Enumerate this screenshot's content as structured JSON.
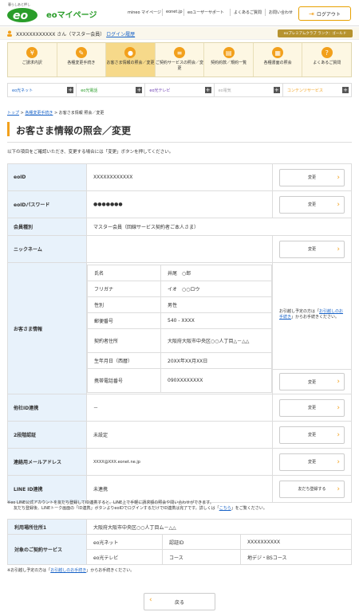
{
  "header": {
    "logo_tagline": "暮らしあと押し",
    "logo_text": "eo",
    "site_name": "eoマイページ",
    "links": [
      "mineo マイページ",
      "eonet.jp",
      "eoユーザーサポート",
      "よくあるご質問",
      "お問い合わせ"
    ],
    "logout_label": "ログアウト"
  },
  "user_bar": {
    "greeting": "XXXXXXXXXXXX さん（マスター会員）",
    "history_link": "ログイン履歴",
    "premium_badge": "eoプレミアムクラブ ランク：ゴールド"
  },
  "main_nav": [
    {
      "label": "ご請求内訳",
      "icon": "yen-icon"
    },
    {
      "label": "各種変更手続き",
      "icon": "pencil-icon"
    },
    {
      "label": "お客さま情報の照会／変更",
      "icon": "person-icon"
    },
    {
      "label": "ご契約サービスの照会／変更",
      "icon": "list-icon"
    },
    {
      "label": "契約約款／規約一覧",
      "icon": "book-icon"
    },
    {
      "label": "各種書面の照会",
      "icon": "document-icon"
    },
    {
      "label": "よくあるご質問",
      "icon": "question-icon"
    }
  ],
  "sub_nav": [
    "eo光ネット",
    "eo光電話",
    "eo光テレビ",
    "eo電気",
    "コンテンツサービス"
  ],
  "breadcrumb": [
    "トップ",
    "各種変更手続き",
    "お客さま情報 照会／変更"
  ],
  "page_title": "お客さま情報の照会／変更",
  "intro": "以下の項目をご確認いただき、変更する場合には「変更」ボタンを押してください。",
  "change_label": "変更",
  "rows": {
    "eoid": {
      "label": "eoID",
      "value": "XXXXXXXXXXXX"
    },
    "password": {
      "label": "eoIDパスワード",
      "value": "●●●●●●●"
    },
    "membership": {
      "label": "会員種別",
      "value": "マスター会員（回線サービス契約者ご本人さま）"
    },
    "nickname": {
      "label": "ニックネーム",
      "value": ""
    },
    "customer": {
      "label": "お客さま情報",
      "name_k": "氏名",
      "name_v": "井尾　○郎",
      "kana_k": "フリガナ",
      "kana_v": "イオ　○○ロウ",
      "sex_k": "性別",
      "sex_v": "男性",
      "zip_k": "郵便番号",
      "zip_v": "540 - XXXX",
      "addr_k": "契約者住所",
      "addr_v": "大阪府大阪市中央区○○人丁目△－△△",
      "birth_k": "生年月日（西暦）",
      "birth_v": "20XX年XX月XX日",
      "mobile_k": "携帯電話番号",
      "mobile_v": "090XXXXXXXX",
      "move_note_pre": "お引越し予定の方は「",
      "move_note_link": "お引越しのお手続き",
      "move_note_post": "」からお手続きください。"
    },
    "other_id": {
      "label": "他社ID連携",
      "value": "－"
    },
    "two_step": {
      "label": "2段階認証",
      "value": "未設定"
    },
    "email": {
      "label": "連絡用メールアドレス",
      "value": "XXXX@XXX.eonet.ne.jp"
    },
    "line": {
      "label": "LINE ID連携",
      "value": "未連携",
      "button": "友だち登録する"
    }
  },
  "line_note_1": "※eo LINE公式アカウントを友だち登録してID連携すると、LINE上で手軽に請求額の照会や問い合わせができます。",
  "line_note_2_pre": "友だち登録後、LINEトーク画面の「ID連携」ボタンよりeoIDでログインするだけでID連携は完了です。詳しくは「",
  "line_note_2_link": "こちら",
  "line_note_2_post": "」をご覧ください。",
  "location": {
    "label": "利用場所住所1",
    "value": "大阪府大阪市中央区○○人丁目ム－△△",
    "services_label": "対象のご契約サービス",
    "s1": "eo光ネット",
    "s1k": "認証ID",
    "s1v": "XXXXXXXXXX",
    "s2": "eo光テレビ",
    "s2k": "コース",
    "s2v": "地デジ・BSコース"
  },
  "move_note_pre": "※お引越し予定の方は「",
  "move_note_link": "お引越しのお手続き",
  "move_note_post": "」からお手続きください。",
  "back_label": "戻る"
}
